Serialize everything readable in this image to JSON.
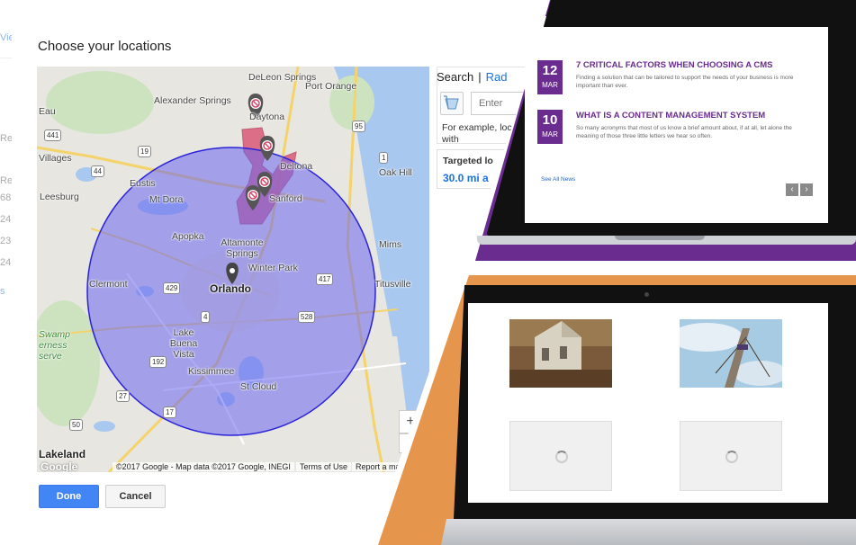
{
  "background_app": {
    "link_fragment": "Vie",
    "row_fragments": [
      "Re",
      "Re",
      "68",
      "24",
      "23",
      "24",
      "s"
    ]
  },
  "dialog": {
    "title": "Choose your locations",
    "done_label": "Done",
    "cancel_label": "Cancel",
    "search_tab": "Search",
    "tab_separator": "|",
    "radius_tab": "Rad",
    "search_placeholder": "Enter",
    "search_help": "For example, locations with",
    "targeted_label": "Targeted lo",
    "targeted_value": "30.0 mi a"
  },
  "map": {
    "places": [
      "DeLeon Springs",
      "Port Orange",
      "Alexander Springs",
      "Deltona",
      "Villages",
      "Eustis",
      "Sanford",
      "Leesburg",
      "Mt Dora",
      "Apopka",
      "Altamonte Springs",
      "Winter Park",
      "Orlando",
      "Mims",
      "Titusville",
      "Clermont",
      "Lake Buena Vista",
      "Kissimmee",
      "St Cloud",
      "Swamp erness serve",
      "Lakeland",
      "Oak Hill",
      "Daytona",
      "Eau"
    ],
    "roads": [
      "441",
      "44",
      "19",
      "429",
      "417",
      "4",
      "528",
      "192",
      "27",
      "95",
      "1",
      "50",
      "17"
    ],
    "attribution": "©2017 Google - Map data ©2017 Google, INEGI",
    "terms": "Terms of Use",
    "report": "Report a ma",
    "logo": "Google",
    "zoom_in": "+",
    "zoom_out": "-",
    "radius_color": "#6a66f0",
    "excluded_color": "#d9466b"
  },
  "news": {
    "items": [
      {
        "day": "12",
        "month": "MAR",
        "title": "7 CRITICAL FACTORS WHEN CHOOSING A CMS",
        "body": "Finding a solution that can be tailored to support the needs of your business is more important than ever."
      },
      {
        "day": "10",
        "month": "MAR",
        "title": "WHAT IS A CONTENT MANAGEMENT SYSTEM",
        "body": "So many acronyms that most of us know a brief amount about, if at all, let alone the meaning of those three little letters we hear so often."
      }
    ],
    "see_all": "See All News",
    "prev": "‹",
    "next": "›",
    "accent": "#6a2c8f"
  },
  "gallery": {
    "accent": "#e5964c"
  }
}
